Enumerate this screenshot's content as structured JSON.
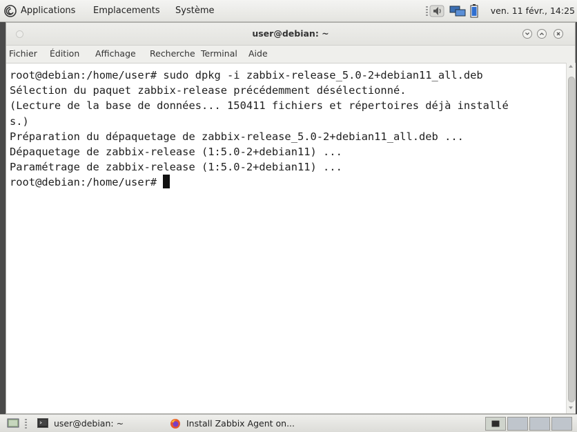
{
  "top_panel": {
    "menus": [
      "Applications",
      "Emplacements",
      "Système"
    ],
    "clock": "ven. 11 févr., 14:25",
    "tray_icons": [
      "volume-icon",
      "network-icon",
      "battery-icon"
    ]
  },
  "window": {
    "title": "user@debian: ~",
    "menubar": [
      "Fichier",
      "Édition",
      "Affichage",
      "Recherche",
      "Terminal",
      "Aide"
    ]
  },
  "terminal": {
    "lines": [
      "root@debian:/home/user# sudo dpkg -i zabbix-release_5.0-2+debian11_all.deb",
      "Sélection du paquet zabbix-release précédemment désélectionné.",
      "(Lecture de la base de données... 150411 fichiers et répertoires déjà installé",
      "s.)",
      "Préparation du dépaquetage de zabbix-release_5.0-2+debian11_all.deb ...",
      "Dépaquetage de zabbix-release (1:5.0-2+debian11) ...",
      "Paramétrage de zabbix-release (1:5.0-2+debian11) ...",
      "root@debian:/home/user# "
    ]
  },
  "taskbar": {
    "tasks": [
      {
        "label": "user@debian: ~",
        "icon": "terminal-icon"
      },
      {
        "label": "Install Zabbix Agent on...",
        "icon": "firefox-icon"
      }
    ],
    "workspace_count": 4,
    "active_workspace": 1
  },
  "colors": {
    "terminal_bg": "#ffffff",
    "terminal_fg": "#1e1e1e",
    "panel_bg": "#e8e8e4"
  }
}
